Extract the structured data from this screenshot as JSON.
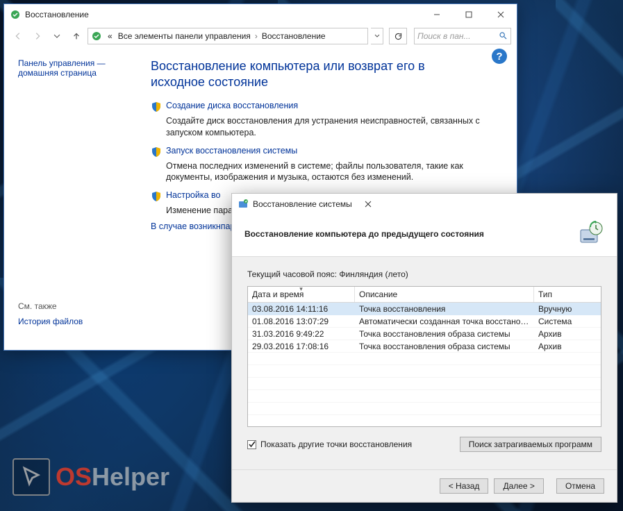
{
  "backWindow": {
    "title": "Восстановление",
    "breadcrumb": {
      "prefix": "«",
      "level1": "Все элементы панели управления",
      "level2": "Восстановление"
    },
    "searchPlaceholder": "Поиск в пан...",
    "side": {
      "homeLine1": "Панель управления —",
      "homeLine2": "домашняя страница",
      "seeAlsoHeader": "См. также",
      "seeAlsoLink": "История файлов"
    },
    "pageTitle": "Восстановление компьютера или возврат его в исходное состояние",
    "sections": [
      {
        "link": "Создание диска восстановления",
        "desc": "Создайте диск восстановления для устранения неисправностей, связанных с запуском компьютера."
      },
      {
        "link": "Запуск восстановления системы",
        "desc": "Отмена последних изменений в системе; файлы пользователя, такие как документы, изображения и музыка, остаются без изменений."
      },
      {
        "link": "Настройка во",
        "desc": "Изменение пара­создание и удале"
      },
      {
        "link": "",
        "desc": "В случае возникн­параметрам и по"
      }
    ]
  },
  "dialog": {
    "title": "Восстановление системы",
    "header": "Восстановление компьютера до предыдущего состояния",
    "timezone": "Текущий часовой пояс: Финляндия (лето)",
    "columns": {
      "dt": "Дата и время",
      "dc": "Описание",
      "tp": "Тип"
    },
    "rows": [
      {
        "dt": "03.08.2016 14:11:16",
        "dc": "Точка восстановления",
        "tp": "Вручную"
      },
      {
        "dt": "01.08.2016 13:07:29",
        "dc": "Автоматически созданная точка восстановле...",
        "tp": "Система"
      },
      {
        "dt": "31.03.2016 9:49:22",
        "dc": "Точка восстановления образа системы",
        "tp": "Архив"
      },
      {
        "dt": "29.03.2016 17:08:16",
        "dc": "Точка восстановления образа системы",
        "tp": "Архив"
      }
    ],
    "showOther": "Показать другие точки восстановления",
    "scanBtn": "Поиск затрагиваемых программ",
    "back": "< Назад",
    "next": "Далее >",
    "cancel": "Отмена"
  },
  "watermark": {
    "os": "OS",
    "helper": "Helper"
  }
}
